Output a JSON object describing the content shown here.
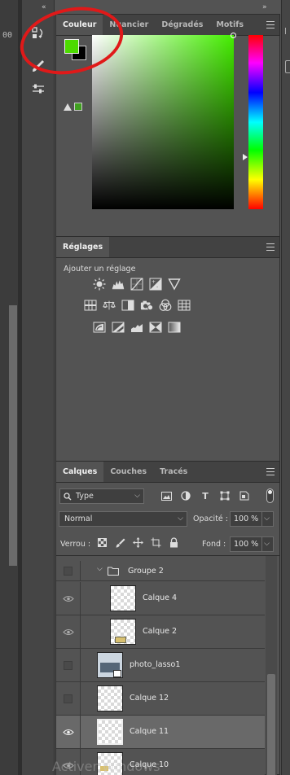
{
  "left_strip": {
    "top_label": "00"
  },
  "color_panel": {
    "tabs": [
      "Couleur",
      "Nuancier",
      "Dégradés",
      "Motifs"
    ],
    "active_tab": "Couleur",
    "foreground_color": "#4cdb00",
    "background_color": "#000000"
  },
  "adjustments_panel": {
    "tab": "Réglages",
    "title": "Ajouter un réglage",
    "icons_row1": [
      "brightness-contrast-icon",
      "levels-icon",
      "curves-icon",
      "exposure-icon",
      "vibrance-icon"
    ],
    "icons_row2": [
      "hue-saturation-icon",
      "color-balance-icon",
      "black-white-icon",
      "photo-filter-icon",
      "channel-mixer-icon",
      "color-lookup-icon"
    ],
    "icons_row3": [
      "invert-icon",
      "posterize-icon",
      "threshold-icon",
      "selective-color-icon",
      "gradient-map-icon"
    ]
  },
  "layers_panel": {
    "tabs": [
      "Calques",
      "Couches",
      "Tracés"
    ],
    "active_tab": "Calques",
    "filter_label": "Type",
    "blend_mode": "Normal",
    "opacity_label": "Opacité :",
    "opacity_value": "100 %",
    "lock_label": "Verrou :",
    "fill_label": "Fond :",
    "fill_value": "100 %",
    "layers": [
      {
        "name": "Groupe 2",
        "type": "group",
        "visible": false
      },
      {
        "name": "Calque 4",
        "type": "layer",
        "visible": true,
        "indent": true
      },
      {
        "name": "Calque 2",
        "type": "layer",
        "visible": true,
        "indent": true
      },
      {
        "name": "photo_lasso1",
        "type": "layer",
        "visible": false
      },
      {
        "name": "Calque 12",
        "type": "layer",
        "visible": false
      },
      {
        "name": "Calque 11",
        "type": "layer",
        "visible": true,
        "selected": true
      },
      {
        "name": "Calque 10",
        "type": "layer",
        "visible": true
      }
    ]
  },
  "watermark": "Activer Windows"
}
